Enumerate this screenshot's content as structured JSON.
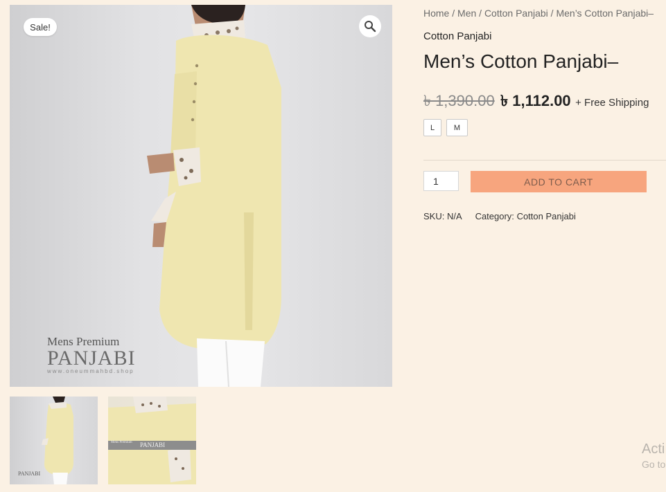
{
  "gallery": {
    "sale_badge": "Sale!",
    "zoom_icon": "search-icon",
    "watermark_line1": "Mens Premium",
    "watermark_line2": "PANJABI",
    "watermark_url": "www.oneummahbd.shop",
    "thumb1_watermark": "PANJABI",
    "thumb2_small_text": "Mens Premium",
    "thumb2_big_text": "PANJABI"
  },
  "breadcrumb": {
    "items": [
      "Home",
      "Men",
      "Cotton Panjabi"
    ],
    "separator": "/",
    "current": "Men’s Cotton Panjabi–"
  },
  "product": {
    "category_link": "Cotton Panjabi",
    "title": "Men’s Cotton Panjabi–",
    "old_price": "৳ 1,390.00",
    "new_price": "৳ 1,112.00",
    "shipping_note": "+ Free Shipping",
    "sizes": [
      "L",
      "M"
    ],
    "quantity": "1",
    "add_to_cart": "ADD TO CART",
    "sku_label": "SKU:",
    "sku_value": "N/A",
    "category_label": "Category:",
    "category_value": "Cotton Panjabi"
  },
  "os_overlay": {
    "line1": "Acti",
    "line2": "Go to"
  },
  "colors": {
    "page_background": "#fbf1e4",
    "add_to_cart_button": "#f7a57e",
    "kurta": "#efe6b0"
  }
}
